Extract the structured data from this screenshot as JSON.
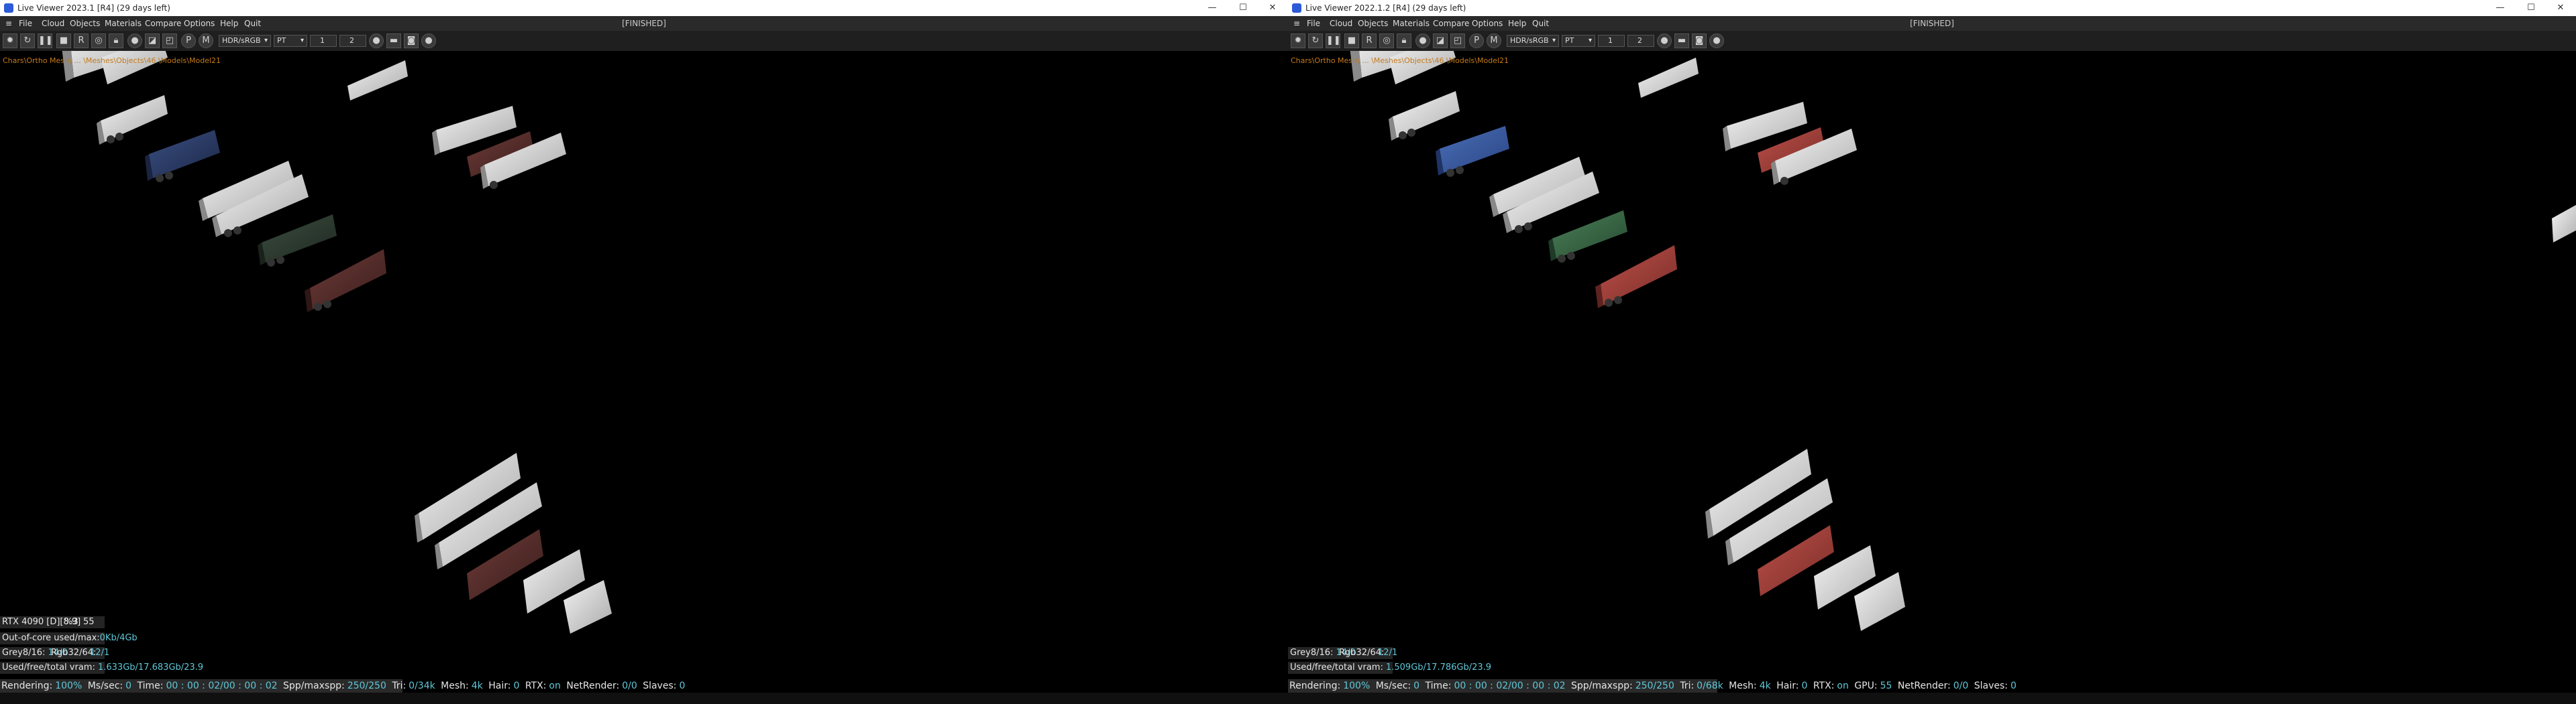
{
  "left": {
    "window_title": "Live Viewer 2023.1 [R4] (29 days left)",
    "menu": [
      "File",
      "Cloud",
      "Objects",
      "Materials",
      "Compare",
      "Options",
      "Help",
      "Quit"
    ],
    "status": "[FINISHED]",
    "toolbar": {
      "kernel": "HDR/sRGB",
      "mode": "PT",
      "num1": "1",
      "num2": "2"
    },
    "overlay_path": "Chars\\Ortho Mesh\\ ... \\Meshes\\Objects\\46 \\Models\\Model21",
    "gpu": {
      "name": "RTX 4090 [D][8.9]",
      "percent": "%3",
      "value": "55"
    },
    "out_of_core": {
      "label": "Out-of-core used/max:",
      "value": "0Kb/4Gb"
    },
    "grey": {
      "label": "Grey8/16:",
      "value": "14/0"
    },
    "rgb": {
      "label": "Rgb32/64:",
      "value": "12/1"
    },
    "vram": {
      "label": "Used/free/total vram:",
      "value": "1.633Gb/17.683Gb/23.9"
    },
    "render": {
      "rendering_label": "Rendering:",
      "rendering": "100%",
      "mss_label": "Ms/sec:",
      "mss": "0",
      "time_label": "Time:",
      "time": "00 : 00 : 02/00 : 00 : 02",
      "spp_label": "Spp/maxspp:",
      "spp": "250/250",
      "tri_label": "Tri:",
      "tri": "0/34k",
      "mesh_label": "Mesh:",
      "mesh": "4k",
      "hair_label": "Hair:",
      "hair": "0",
      "rtx_label": "RTX:",
      "rtx": "on",
      "netrender_label": "NetRender:",
      "netrender": "0/0",
      "slaves_label": "Slaves:",
      "slaves": "0"
    }
  },
  "right": {
    "window_title": "Live Viewer 2022.1.2 [R4] (29 days left)",
    "menu": [
      "File",
      "Cloud",
      "Objects",
      "Materials",
      "Compare",
      "Options",
      "Help",
      "Quit"
    ],
    "status": "[FINISHED]",
    "toolbar": {
      "kernel": "HDR/sRGB",
      "mode": "PT",
      "num1": "1",
      "num2": "2"
    },
    "overlay_path": "Chars\\Ortho Mesh\\ ... \\Meshes\\Objects\\46 \\Models\\Model21",
    "grey": {
      "label": "Grey8/16:",
      "value": "14/0"
    },
    "rgb": {
      "label": "Rgb32/64:",
      "value": "12/1"
    },
    "vram": {
      "label": "Used/free/total vram:",
      "value": "1.509Gb/17.786Gb/23.9"
    },
    "render": {
      "rendering_label": "Rendering:",
      "rendering": "100%",
      "mss_label": "Ms/sec:",
      "mss": "0",
      "time_label": "Time:",
      "time": "00 : 00 : 02/00 : 00 : 02",
      "spp_label": "Spp/maxspp:",
      "spp": "250/250",
      "tri_label": "Tri:",
      "tri": "0/68k",
      "mesh_label": "Mesh:",
      "mesh": "4k",
      "hair_label": "Hair:",
      "hair": "0",
      "rtx_label": "RTX:",
      "rtx": "on",
      "gpu_label": "GPU:",
      "gpu": "55",
      "netrender_label": "NetRender:",
      "netrender": "0/0",
      "slaves_label": "Slaves:",
      "slaves": "0"
    }
  },
  "window_buttons": {
    "minimize": "—",
    "maximize": "☐",
    "close": "✕"
  },
  "colors": {
    "white_trailer": "#d8d8d8",
    "blue_trailer_left": "#2c3d66",
    "blue_trailer_right": "#3a5ea8",
    "green_trailer_left": "#2e3d33",
    "green_trailer_right": "#3b6b47",
    "red_trailer_left": "#5e3230",
    "red_trailer_right": "#a8433d",
    "highlight": "#5ec8d8"
  }
}
